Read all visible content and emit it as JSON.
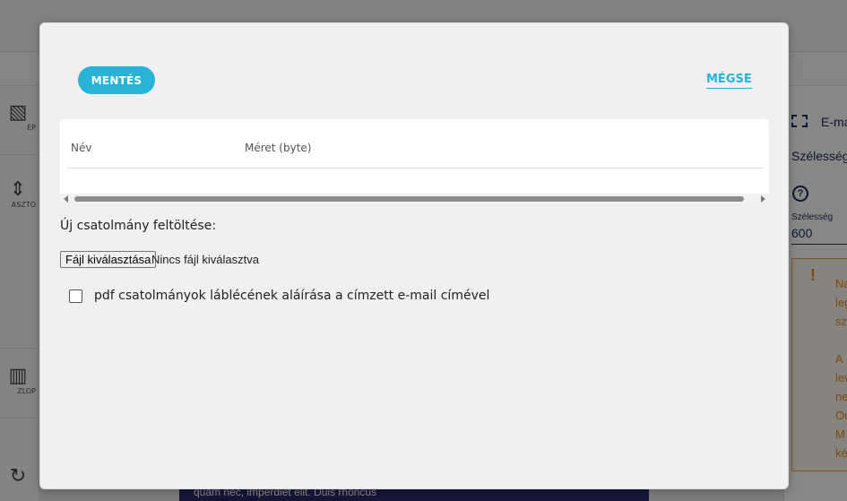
{
  "background": {
    "left_tools": [
      {
        "label": "ÉP",
        "icon": "image-icon"
      },
      {
        "label": "ASZTÓ",
        "icon": "divider-icon"
      },
      {
        "label": "ZLOP",
        "icon": "columns-icon"
      },
      {
        "label": "",
        "icon": "refresh-icon"
      }
    ],
    "right_panel": {
      "email_label": "E-ma",
      "width_title": "Szélesség",
      "width_small_label": "Szélesség",
      "width_value": "600",
      "warning_lines": [
        "Na",
        "leg",
        "sz",
        "A",
        "lev",
        "ne",
        "Ou",
        "M",
        "ké"
      ]
    },
    "canvas_text": "quam nec, imperdiet elit. Duis rhoncus"
  },
  "modal": {
    "save_label": "MENTÉS",
    "cancel_label": "MÉGSE",
    "table": {
      "columns": [
        "Név",
        "Méret (byte)"
      ],
      "rows": []
    },
    "upload_label": "Új csatolmány feltöltése:",
    "file_button_label": "Fájl kiválasztása",
    "file_status": "Nincs fájl kiválasztva",
    "checkbox_label": "pdf csatolmányok láblécének aláírása a címzett e-mail címével",
    "checkbox_checked": false
  },
  "colors": {
    "accent": "#26b3d6",
    "modal_bg": "#f2eff2",
    "warning": "#e88a19",
    "navy": "#1f2a57",
    "purple_block": "#2c2a6b"
  }
}
